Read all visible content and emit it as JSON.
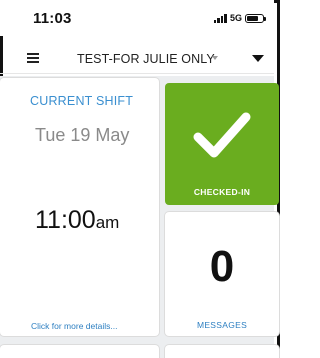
{
  "status_bar": {
    "time": "11:03",
    "network": "5G"
  },
  "header": {
    "title": "TEST-FOR JULIE ONLY"
  },
  "current_shift": {
    "label": "CURRENT SHIFT",
    "date": "Tue 19 May",
    "time_number": "11:00",
    "time_suffix": "am",
    "details_link": "Click for more details..."
  },
  "checked_in": {
    "label": "CHECKED-IN",
    "color": "#6aad1f"
  },
  "messages": {
    "count": "0",
    "label": "MESSAGES"
  },
  "colors": {
    "accent_blue": "#3a8fd0",
    "background": "#eceef0"
  }
}
